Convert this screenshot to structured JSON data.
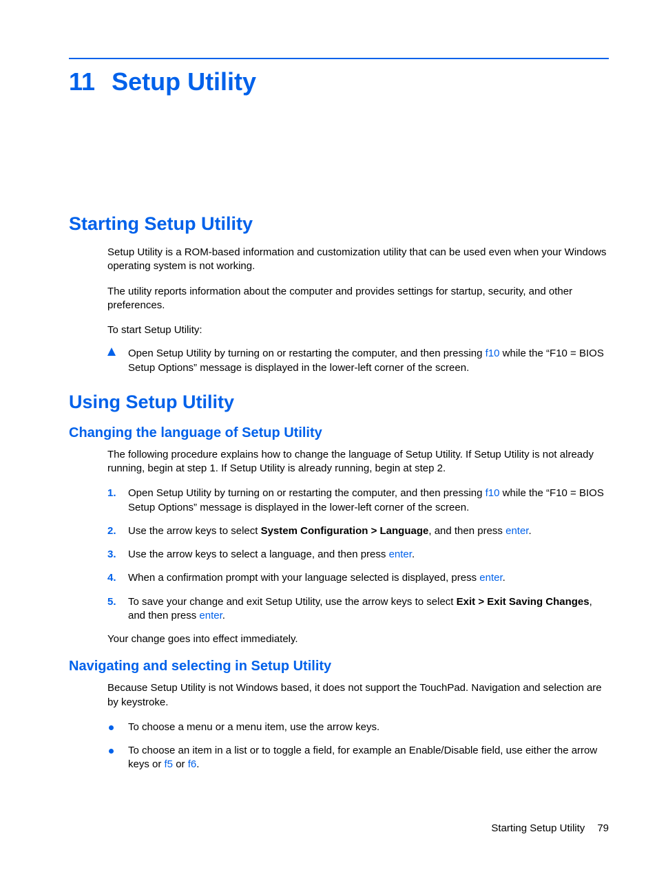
{
  "chapter": {
    "number": "11",
    "title": "Setup Utility"
  },
  "section1": {
    "heading": "Starting Setup Utility",
    "p1": "Setup Utility is a ROM-based information and customization utility that can be used even when your Windows operating system is not working.",
    "p2": "The utility reports information about the computer and provides settings for startup, security, and other preferences.",
    "p3": "To start Setup Utility:",
    "step": {
      "pre": "Open Setup Utility by turning on or restarting the computer, and then pressing ",
      "key": "f10",
      "post": " while the “F10 = BIOS Setup Options” message is displayed in the lower-left corner of the screen."
    }
  },
  "section2": {
    "heading": "Using Setup Utility",
    "sub1": {
      "heading": "Changing the language of Setup Utility",
      "intro": "The following procedure explains how to change the language of Setup Utility. If Setup Utility is not already running, begin at step 1. If Setup Utility is already running, begin at step 2.",
      "steps": {
        "s1": {
          "n": "1.",
          "pre": "Open Setup Utility by turning on or restarting the computer, and then pressing ",
          "key": "f10",
          "post": " while the “F10 = BIOS Setup Options” message is displayed in the lower-left corner of the screen."
        },
        "s2": {
          "n": "2.",
          "pre": "Use the arrow keys to select ",
          "bold": "System Configuration > Language",
          "mid": ", and then press ",
          "key": "enter",
          "post": "."
        },
        "s3": {
          "n": "3.",
          "pre": "Use the arrow keys to select a language, and then press ",
          "key": "enter",
          "post": "."
        },
        "s4": {
          "n": "4.",
          "pre": "When a confirmation prompt with your language selected is displayed, press ",
          "key": "enter",
          "post": "."
        },
        "s5": {
          "n": "5.",
          "pre": "To save your change and exit Setup Utility, use the arrow keys to select ",
          "bold": "Exit > Exit Saving Changes",
          "mid": ", and then press ",
          "key": "enter",
          "post": "."
        }
      },
      "outro": "Your change goes into effect immediately."
    },
    "sub2": {
      "heading": "Navigating and selecting in Setup Utility",
      "intro": "Because Setup Utility is not Windows based, it does not support the TouchPad. Navigation and selection are by keystroke.",
      "b1": "To choose a menu or a menu item, use the arrow keys.",
      "b2": {
        "pre": "To choose an item in a list or to toggle a field, for example an Enable/Disable field, use either the arrow keys or ",
        "k1": "f5",
        "or": " or ",
        "k2": "f6",
        "post": "."
      }
    }
  },
  "footer": {
    "label": "Starting Setup Utility",
    "page": "79"
  }
}
